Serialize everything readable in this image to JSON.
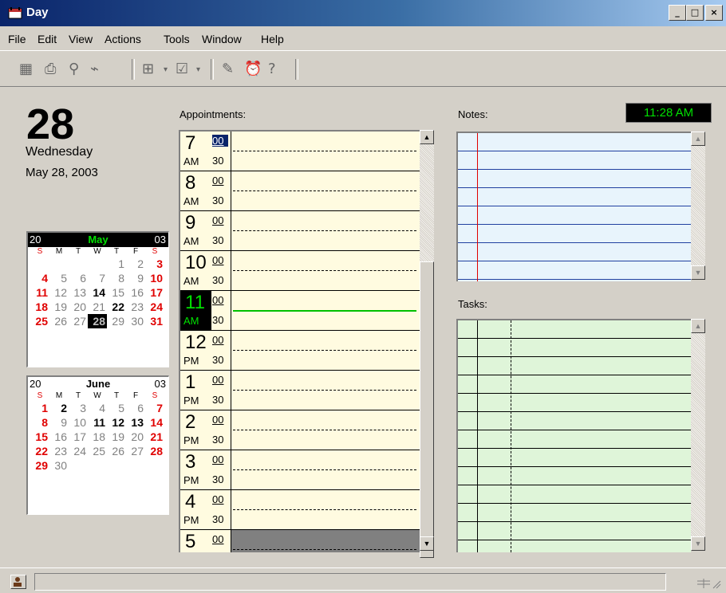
{
  "window": {
    "title": "Day",
    "controls": {
      "minimize": "_",
      "maximize": "□",
      "close": "×"
    }
  },
  "menu": [
    "File",
    "Edit",
    "View",
    "Actions",
    "Tools",
    "Window",
    "Help"
  ],
  "toolbar_icons": [
    "properties-icon",
    "print-icon",
    "find-icon",
    "link-icon",
    "new-appointment-icon",
    "new-task-icon",
    "alarm-icon",
    "reminder-icon",
    "help-icon"
  ],
  "date": {
    "day_number": "28",
    "weekday": "Wednesday",
    "full_date": "May 28, 2003"
  },
  "labels": {
    "appointments": "Appointments:",
    "notes": "Notes:",
    "tasks": "Tasks:"
  },
  "clock": "11:28 AM",
  "calendars": [
    {
      "century": "20",
      "month": "May",
      "year": "03",
      "day_names": [
        "S",
        "M",
        "T",
        "W",
        "T",
        "F",
        "S"
      ],
      "days": [
        "",
        "",
        "",
        "",
        "1",
        "2",
        "3",
        "4",
        "5",
        "6",
        "7",
        "8",
        "9",
        "10",
        "11",
        "12",
        "13",
        "14",
        "15",
        "16",
        "17",
        "18",
        "19",
        "20",
        "21",
        "22",
        "23",
        "24",
        "25",
        "26",
        "27",
        "28",
        "29",
        "30",
        "31"
      ]
    },
    {
      "century": "20",
      "month": "June",
      "year": "03",
      "day_names": [
        "S",
        "M",
        "T",
        "W",
        "T",
        "F",
        "S"
      ],
      "days": [
        "1",
        "2",
        "3",
        "4",
        "5",
        "6",
        "7",
        "8",
        "9",
        "10",
        "11",
        "12",
        "13",
        "14",
        "15",
        "16",
        "17",
        "18",
        "19",
        "20",
        "21",
        "22",
        "23",
        "24",
        "25",
        "26",
        "27",
        "28",
        "29",
        "30"
      ]
    }
  ],
  "hours": [
    {
      "hour": "7",
      "ampm": "AM",
      "m00": "00",
      "m30": "30"
    },
    {
      "hour": "8",
      "ampm": "AM",
      "m00": "00",
      "m30": "30"
    },
    {
      "hour": "9",
      "ampm": "AM",
      "m00": "00",
      "m30": "30"
    },
    {
      "hour": "10",
      "ampm": "AM",
      "m00": "00",
      "m30": "30"
    },
    {
      "hour": "11",
      "ampm": "AM",
      "m00": "00",
      "m30": "30"
    },
    {
      "hour": "12",
      "ampm": "PM",
      "m00": "00",
      "m30": "30"
    },
    {
      "hour": "1",
      "ampm": "PM",
      "m00": "00",
      "m30": "30"
    },
    {
      "hour": "2",
      "ampm": "PM",
      "m00": "00",
      "m30": "30"
    },
    {
      "hour": "3",
      "ampm": "PM",
      "m00": "00",
      "m30": "30"
    },
    {
      "hour": "4",
      "ampm": "PM",
      "m00": "00",
      "m30": "30"
    },
    {
      "hour": "5",
      "ampm": "",
      "m00": "00",
      "m30": ""
    }
  ],
  "colors": {
    "title_start": "#0a246a",
    "title_end": "#a6caf0",
    "clock_text": "#00e000",
    "weekend_red": "#e00000",
    "notes_bg": "#e8f4fc",
    "tasks_bg": "#dff5d9",
    "appt_bg": "#fffbe0"
  }
}
